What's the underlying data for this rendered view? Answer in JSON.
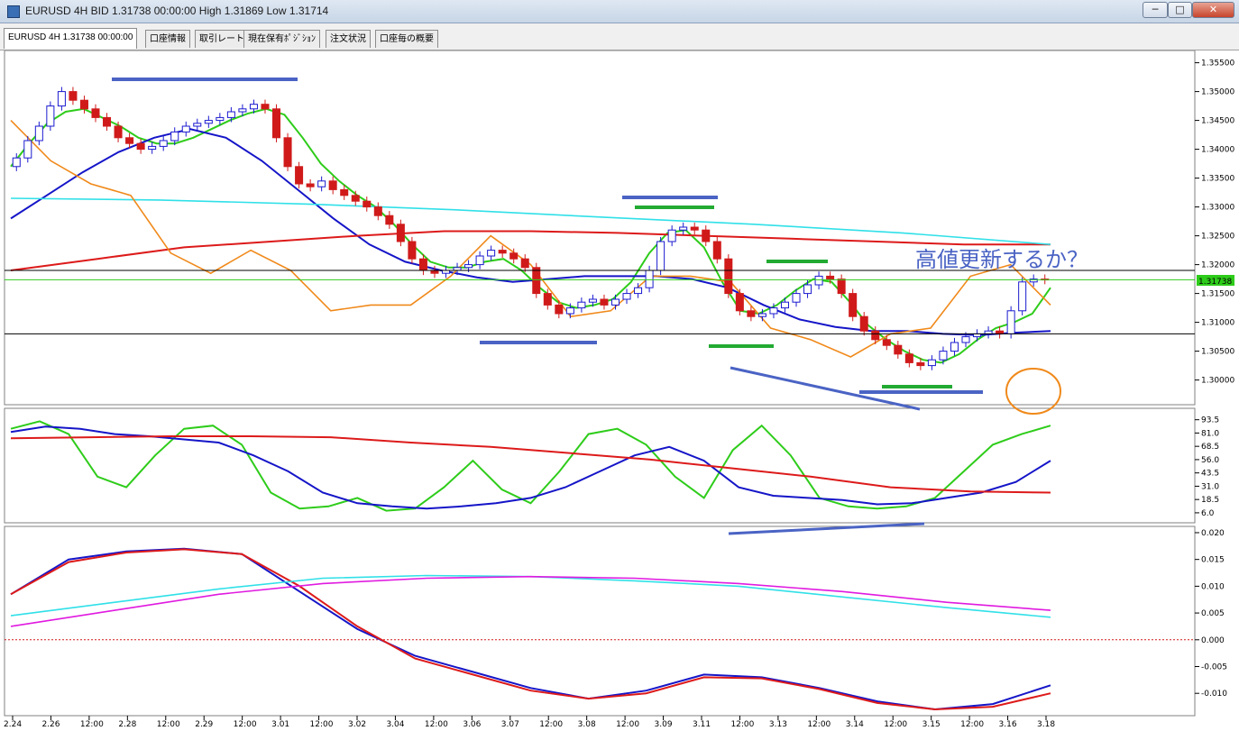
{
  "window": {
    "title": "EURUSD 4H BID 1.31738 00:00:00 High 1.31869 Low 1.31714",
    "icon": "chart-window-icon",
    "buttons": {
      "minimize": "─",
      "maximize": "□",
      "close": "✕"
    }
  },
  "tabs": [
    {
      "label": "EURUSD 4H 1.31738 00:00:00",
      "active": true
    },
    {
      "label": "口座情報",
      "active": false
    },
    {
      "label": "取引レート",
      "active": false
    },
    {
      "label": "現在保有ﾎﾟｼﾞｼｮﾝ",
      "active": false
    },
    {
      "label": "注文状況",
      "active": false
    },
    {
      "label": "口座毎の概要",
      "active": false
    }
  ],
  "annotation": {
    "text": "高値更新するか？",
    "color": "#4a63c4"
  },
  "current_price_label": "1.31738",
  "colors": {
    "bull_candle": "#1a1ad0",
    "bear_candle": "#d01a1a",
    "ma_fast": "#2ecc1a",
    "ma_mid": "#1515c8",
    "ma_slow": "#dd1a1a",
    "ma_long": "#30e0e8",
    "bollinger": "#1e8a7a",
    "envelope": "#7a1a7a",
    "orange_line": "#f0891a",
    "highlight_blue": "#4a63c4",
    "highlight_green": "#22aa33"
  },
  "chart_data": [
    {
      "type": "candlestick",
      "panel": "main",
      "y_axis_ticks": [
        "1.35500",
        "1.35000",
        "1.34500",
        "1.34000",
        "1.33500",
        "1.33000",
        "1.32500",
        "1.32000",
        "1.31500",
        "1.31000",
        "1.30500",
        "1.30000"
      ],
      "ylim": [
        1.2965,
        1.3565
      ],
      "current_price": 1.31738,
      "horizontal_lines": [
        1.319,
        1.308
      ],
      "close_prices": [
        1.3385,
        1.3415,
        1.344,
        1.3475,
        1.35,
        1.3485,
        1.347,
        1.3455,
        1.344,
        1.342,
        1.341,
        1.34,
        1.3405,
        1.3415,
        1.343,
        1.344,
        1.3445,
        1.345,
        1.3455,
        1.3465,
        1.347,
        1.3478,
        1.347,
        1.342,
        1.337,
        1.334,
        1.3335,
        1.3345,
        1.333,
        1.332,
        1.331,
        1.33,
        1.3285,
        1.327,
        1.324,
        1.321,
        1.319,
        1.3185,
        1.319,
        1.3195,
        1.32,
        1.3215,
        1.3225,
        1.322,
        1.321,
        1.3195,
        1.315,
        1.313,
        1.3115,
        1.3125,
        1.3135,
        1.314,
        1.313,
        1.314,
        1.315,
        1.316,
        1.319,
        1.324,
        1.326,
        1.3265,
        1.326,
        1.324,
        1.321,
        1.315,
        1.312,
        1.311,
        1.3115,
        1.3125,
        1.3135,
        1.315,
        1.3165,
        1.318,
        1.3175,
        1.315,
        1.311,
        1.3085,
        1.307,
        1.306,
        1.3045,
        1.303,
        1.3025,
        1.3035,
        1.305,
        1.3065,
        1.3075,
        1.308,
        1.3085,
        1.308,
        1.312,
        1.317,
        1.3175,
        1.3174
      ],
      "series": [
        {
          "name": "",
          "style": "ma_fast",
          "values": [
            1.337,
            1.341,
            1.3445,
            1.3465,
            1.347,
            1.3455,
            1.344,
            1.342,
            1.341,
            1.341,
            1.342,
            1.3435,
            1.345,
            1.3462,
            1.347,
            1.346,
            1.342,
            1.3375,
            1.3345,
            1.332,
            1.33,
            1.327,
            1.3235,
            1.3205,
            1.3195,
            1.3195,
            1.3205,
            1.321,
            1.319,
            1.316,
            1.3135,
            1.3125,
            1.313,
            1.314,
            1.317,
            1.322,
            1.3255,
            1.326,
            1.323,
            1.317,
            1.312,
            1.3115,
            1.313,
            1.3155,
            1.3175,
            1.317,
            1.3135,
            1.3095,
            1.307,
            1.305,
            1.3035,
            1.303,
            1.3045,
            1.307,
            1.309,
            1.31,
            1.3115,
            1.316
          ]
        },
        {
          "name": "",
          "style": "ma_mid",
          "values": [
            1.328,
            1.332,
            1.336,
            1.3395,
            1.342,
            1.3435,
            1.342,
            1.338,
            1.333,
            1.328,
            1.3235,
            1.3205,
            1.319,
            1.3178,
            1.317,
            1.3175,
            1.318,
            1.318,
            1.318,
            1.3175,
            1.316,
            1.313,
            1.3105,
            1.3092,
            1.3085,
            1.3085,
            1.308,
            1.3078,
            1.3082,
            1.3085
          ]
        },
        {
          "name": "",
          "style": "ma_slow",
          "values": [
            1.319,
            1.321,
            1.323,
            1.324,
            1.325,
            1.3258,
            1.3258,
            1.3255,
            1.325,
            1.3245,
            1.324,
            1.3235,
            1.3235
          ]
        },
        {
          "name": "",
          "style": "ma_long",
          "values": [
            1.3315,
            1.3312,
            1.3305,
            1.3295,
            1.3282,
            1.327,
            1.3255,
            1.3235
          ]
        },
        {
          "name": "",
          "style": "orange_line",
          "values": [
            1.345,
            1.338,
            1.334,
            1.332,
            1.322,
            1.3185,
            1.3225,
            1.319,
            1.312,
            1.313,
            1.313,
            1.318,
            1.325,
            1.32,
            1.311,
            1.312,
            1.318,
            1.318,
            1.317,
            1.309,
            1.307,
            1.304,
            1.308,
            1.309,
            1.318,
            1.32,
            1.313
          ]
        }
      ]
    },
    {
      "type": "line",
      "panel": "stochastic",
      "y_axis_ticks": [
        "93.5",
        "81.0",
        "68.5",
        "56.0",
        "43.5",
        "31.0",
        "18.5",
        "6.0"
      ],
      "ylim": [
        0,
        100
      ],
      "series": [
        {
          "name": "",
          "style": "ma_fast",
          "values": [
            85,
            92,
            80,
            40,
            30,
            60,
            85,
            88,
            70,
            25,
            10,
            12,
            20,
            8,
            10,
            30,
            55,
            28,
            15,
            45,
            80,
            85,
            70,
            40,
            20,
            65,
            88,
            60,
            20,
            12,
            10,
            12,
            20,
            45,
            70,
            80,
            88
          ]
        },
        {
          "name": "",
          "style": "ma_mid",
          "values": [
            82,
            87,
            85,
            80,
            78,
            75,
            72,
            60,
            45,
            25,
            15,
            12,
            10,
            12,
            15,
            20,
            30,
            45,
            60,
            68,
            55,
            30,
            22,
            20,
            18,
            14,
            15,
            20,
            25,
            35,
            55
          ]
        },
        {
          "name": "",
          "style": "ma_slow",
          "values": [
            76,
            77,
            78,
            78,
            77,
            72,
            68,
            62,
            56,
            48,
            40,
            30,
            26,
            25
          ]
        }
      ]
    },
    {
      "type": "line",
      "panel": "macd",
      "y_axis_ticks": [
        "0.020",
        "0.015",
        "0.010",
        "0.005",
        "0.000",
        "-0.005",
        "-0.010"
      ],
      "ylim": [
        -0.0135,
        0.0205
      ],
      "series": [
        {
          "name": "",
          "style": "ma_mid",
          "values": [
            0.0085,
            0.015,
            0.0165,
            0.017,
            0.016,
            0.009,
            0.002,
            -0.003,
            -0.006,
            -0.009,
            -0.011,
            -0.0095,
            -0.0065,
            -0.007,
            -0.009,
            -0.0115,
            -0.013,
            -0.012,
            -0.0085
          ]
        },
        {
          "name": "",
          "style": "ma_slow",
          "values": [
            0.0085,
            0.0145,
            0.0163,
            0.0169,
            0.016,
            0.01,
            0.0025,
            -0.0035,
            -0.0065,
            -0.0095,
            -0.011,
            -0.01,
            -0.007,
            -0.0072,
            -0.0092,
            -0.0118,
            -0.013,
            -0.0125,
            -0.01
          ]
        },
        {
          "name": "",
          "style": "ma_long",
          "values": [
            0.0045,
            0.007,
            0.0095,
            0.0115,
            0.012,
            0.0118,
            0.011,
            0.01,
            0.008,
            0.006,
            0.0042
          ]
        },
        {
          "name": "",
          "style": "envelope_magenta",
          "values": [
            0.0025,
            0.0055,
            0.0085,
            0.0105,
            0.0115,
            0.0118,
            0.0115,
            0.0105,
            0.009,
            0.007,
            0.0055
          ]
        }
      ]
    }
  ],
  "x_axis_labels": [
    "2.24",
    "2.26",
    "12:00",
    "2.28",
    "12:00",
    "2.29",
    "12:00",
    "3.01",
    "12:00",
    "3.02",
    "3.04",
    "12:00",
    "3.06",
    "3.07",
    "12:00",
    "3.08",
    "12:00",
    "3.09",
    "3.11",
    "12:00",
    "3.13",
    "12:00",
    "3.14",
    "12:00",
    "3.15",
    "12:00",
    "3.16",
    "3.18"
  ]
}
